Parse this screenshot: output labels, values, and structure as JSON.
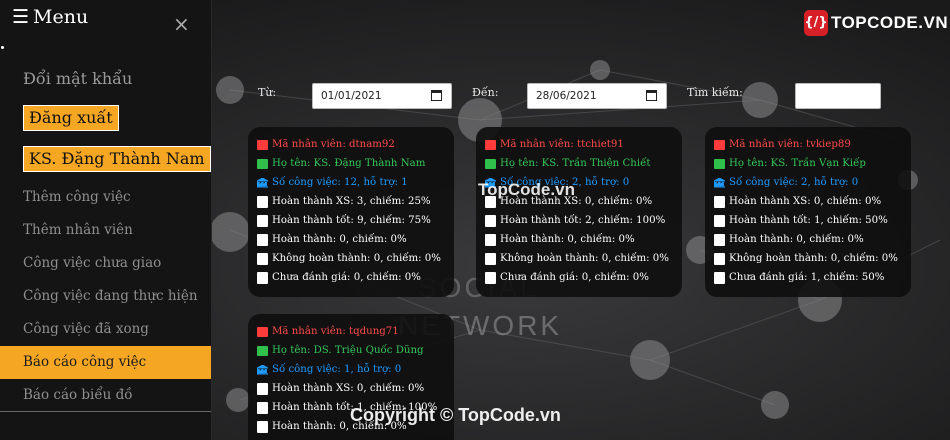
{
  "sidebar": {
    "title": "Menu",
    "close_glyph": "×",
    "change_password": "Đổi mật khẩu",
    "logout": "Đăng xuất",
    "user": "KS. Đặng Thành Nam",
    "items": [
      {
        "label": "Thêm công việc"
      },
      {
        "label": "Thêm nhân viên"
      },
      {
        "label": "Công việc chưa giao"
      },
      {
        "label": "Công việc đang thực hiện"
      },
      {
        "label": "Công việc đã xong"
      },
      {
        "label": "Báo cáo công việc",
        "active": true
      },
      {
        "label": "Báo cáo biểu đồ"
      }
    ]
  },
  "logo": {
    "icon": "{/}",
    "text": "TOPCODE.VN"
  },
  "filters": {
    "from_label": "Từ:",
    "from_value": "01/01/2021",
    "to_label": "Đến:",
    "to_value": "28/06/2021",
    "search_label": "Tìm kiếm:",
    "search_value": ""
  },
  "cards": [
    {
      "employee_id": "Mã nhân viên: dtnam92",
      "name": "Họ tên: KS. Đặng Thành Nam",
      "tasks": "Số công việc: 12, hỗ trợ: 1",
      "excellent": "Hoàn thành XS: 3, chiếm: 25%",
      "good": "Hoàn thành tốt: 9, chiếm: 75%",
      "done": "Hoàn thành: 0, chiếm: 0%",
      "not_done": "Không hoàn thành: 0, chiếm: 0%",
      "unrated": "Chưa đánh giá: 0, chiếm: 0%"
    },
    {
      "employee_id": "Mã nhân viên: ttchiet91",
      "name": "Họ tên: KS. Trần Thiện Chiết",
      "tasks": "Số công việc: 2, hỗ trợ: 0",
      "excellent": "Hoàn thành XS: 0, chiếm: 0%",
      "good": "Hoàn thành tốt: 2, chiếm: 100%",
      "done": "Hoàn thành: 0, chiếm: 0%",
      "not_done": "Không hoàn thành: 0, chiếm: 0%",
      "unrated": "Chưa đánh giá: 0, chiếm: 0%"
    },
    {
      "employee_id": "Mã nhân viên: tvkiep89",
      "name": "Họ tên: KS. Trần Vạn Kiếp",
      "tasks": "Số công việc: 2, hỗ trợ: 0",
      "excellent": "Hoàn thành XS: 0, chiếm: 0%",
      "good": "Hoàn thành tốt: 1, chiếm: 50%",
      "done": "Hoàn thành: 0, chiếm: 0%",
      "not_done": "Không hoàn thành: 0, chiếm: 0%",
      "unrated": "Chưa đánh giá: 1, chiếm: 50%"
    },
    {
      "employee_id": "Mã nhân viên: tqdung71",
      "name": "Họ tên: DS. Triệu Quốc Dũng",
      "tasks": "Số công việc: 1, hỗ trợ: 0",
      "excellent": "Hoàn thành XS: 0, chiếm: 0%",
      "good": "Hoàn thành tốt: 1, chiếm: 100%",
      "done": "Hoàn thành: 0, chiếm: 0%",
      "not_done": "",
      "unrated": ""
    }
  ],
  "watermarks": {
    "center_logo": "TopCode.vn",
    "copyright": "Copyright © TopCode.vn",
    "bg_word1": "SOCIAL",
    "bg_word2": "NETWORK"
  },
  "colors": {
    "accent": "#f5a623",
    "id_red": "#ff4b4b",
    "name_green": "#34c759",
    "tasks_blue": "#1e9bff",
    "sidebar_bg": "#141414"
  }
}
